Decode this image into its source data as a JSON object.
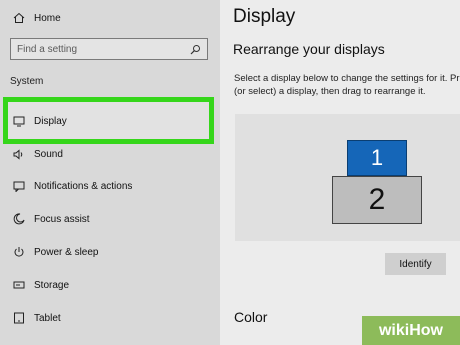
{
  "sidebar": {
    "home_label": "Home",
    "search_placeholder": "Find a setting",
    "section_label": "System",
    "items": [
      {
        "label": "Display"
      },
      {
        "label": "Sound"
      },
      {
        "label": "Notifications & actions"
      },
      {
        "label": "Focus assist"
      },
      {
        "label": "Power & sleep"
      },
      {
        "label": "Storage"
      },
      {
        "label": "Tablet"
      }
    ]
  },
  "main": {
    "title": "Display",
    "subtitle": "Rearrange your displays",
    "description_line1": "Select a display below to change the settings for it. Pr",
    "description_line2": "(or select) a display, then drag to rearrange it.",
    "monitor_1": "1",
    "monitor_2": "2",
    "identify_label": "Identify",
    "color_heading": "Color"
  },
  "watermark": {
    "text": "wikiHow"
  },
  "colors": {
    "highlight": "#35d61a",
    "monitor_1": "#1566b8",
    "sidebar_bg": "#d9d9d9"
  },
  "icons": [
    "home-icon",
    "search-icon",
    "display-icon",
    "sound-icon",
    "notifications-icon",
    "focus-assist-icon",
    "power-icon",
    "storage-icon",
    "tablet-icon"
  ]
}
